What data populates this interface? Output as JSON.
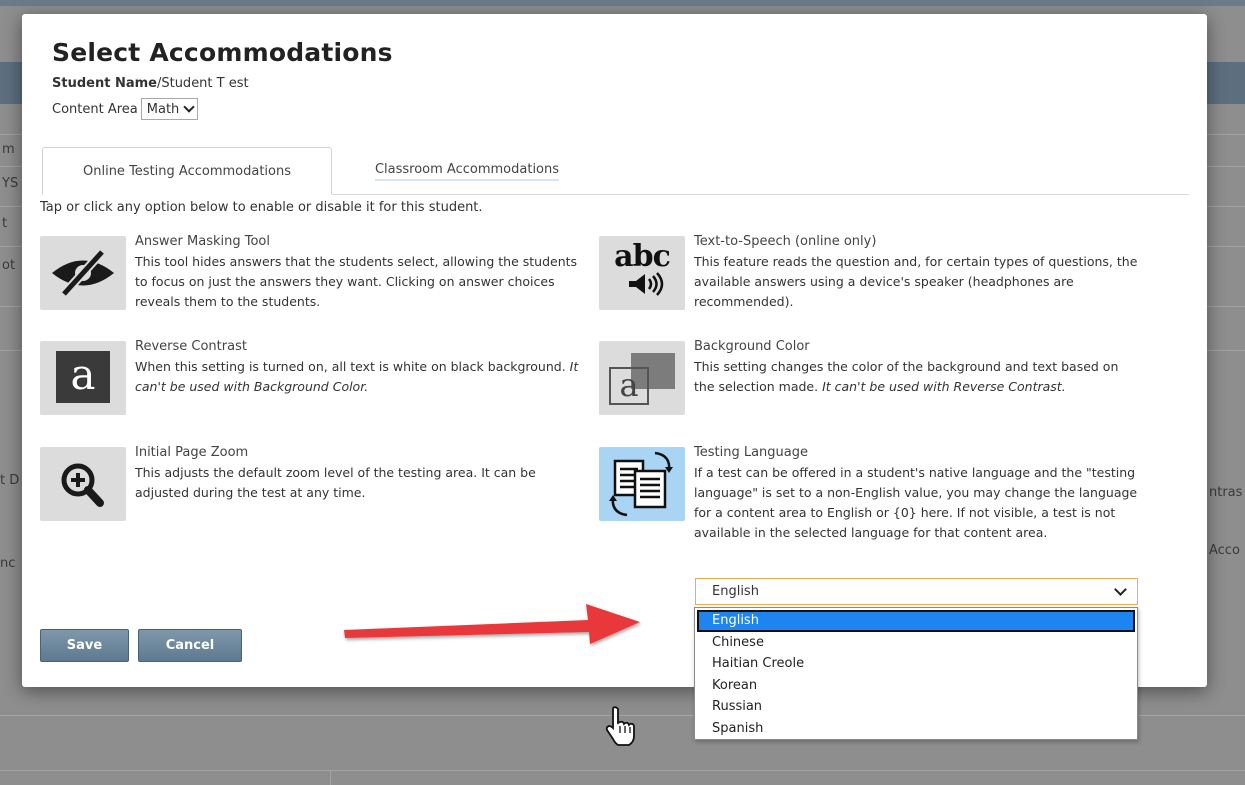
{
  "modal": {
    "title": "Select Accommodations",
    "student_label": "Student Name",
    "student_value": "/Student T est",
    "content_area_label": "Content Area",
    "content_area_value": "Math"
  },
  "tabs": [
    {
      "label": "Online Testing Accommodations",
      "active": true
    },
    {
      "label": "Classroom Accommodations",
      "active": false
    }
  ],
  "instruction": "Tap or click any option below to enable or disable it for this student.",
  "accommodations": {
    "answer_masking": {
      "icon": "eye-slash-icon",
      "title": "Answer Masking Tool",
      "description": "This tool hides answers that the students select, allowing the students to focus on just the answers they want. Clicking on answer choices reveals them to the students."
    },
    "tts": {
      "icon": "abc-speaker-icon",
      "icon_text": "abc",
      "title": "Text-to-Speech (online only)",
      "description": "This feature reads the question and, for certain types of questions, the available answers using a device's speaker (headphones are recommended)."
    },
    "reverse_contrast": {
      "icon": "reverse-contrast-icon",
      "icon_text": "a",
      "title": "Reverse Contrast",
      "description": "When this setting is turned on, all text is white on black background. ",
      "note": "It can't be used with Background Color."
    },
    "background_color": {
      "icon": "background-color-icon",
      "icon_text": "a",
      "title": "Background Color",
      "description": "This setting changes the color of the background and text based on the selection made. ",
      "note": "It can't be used with Reverse Contrast."
    },
    "page_zoom": {
      "icon": "zoom-in-icon",
      "title": "Initial Page Zoom",
      "description": "This adjusts the default zoom level of the testing area. It can be adjusted during the test at any time."
    },
    "testing_language": {
      "icon": "language-documents-icon",
      "title": "Testing Language",
      "description": "If a test can be offered in a student's native language and the \"testing language\" is set to a non-English value, you may change the language for a content area to English or {0} here. If not visible, a test is not available in the selected language for that content area.",
      "selected": "English",
      "options": [
        "English",
        "Chinese",
        "Haitian Creole",
        "Korean",
        "Russian",
        "Spanish"
      ]
    }
  },
  "buttons": {
    "save": "Save",
    "cancel": "Cancel"
  },
  "background_fragments": [
    "m",
    "YS",
    "t",
    "ot",
    "t D",
    "ntras",
    "nc",
    "Acco"
  ],
  "colors": {
    "button": "#6b8599",
    "dropdown_highlight": "#1e84f0",
    "select_focus_border": "#f0ad4e",
    "language_icon_bg": "#a9d4f4",
    "arrow": "#e8383a"
  }
}
